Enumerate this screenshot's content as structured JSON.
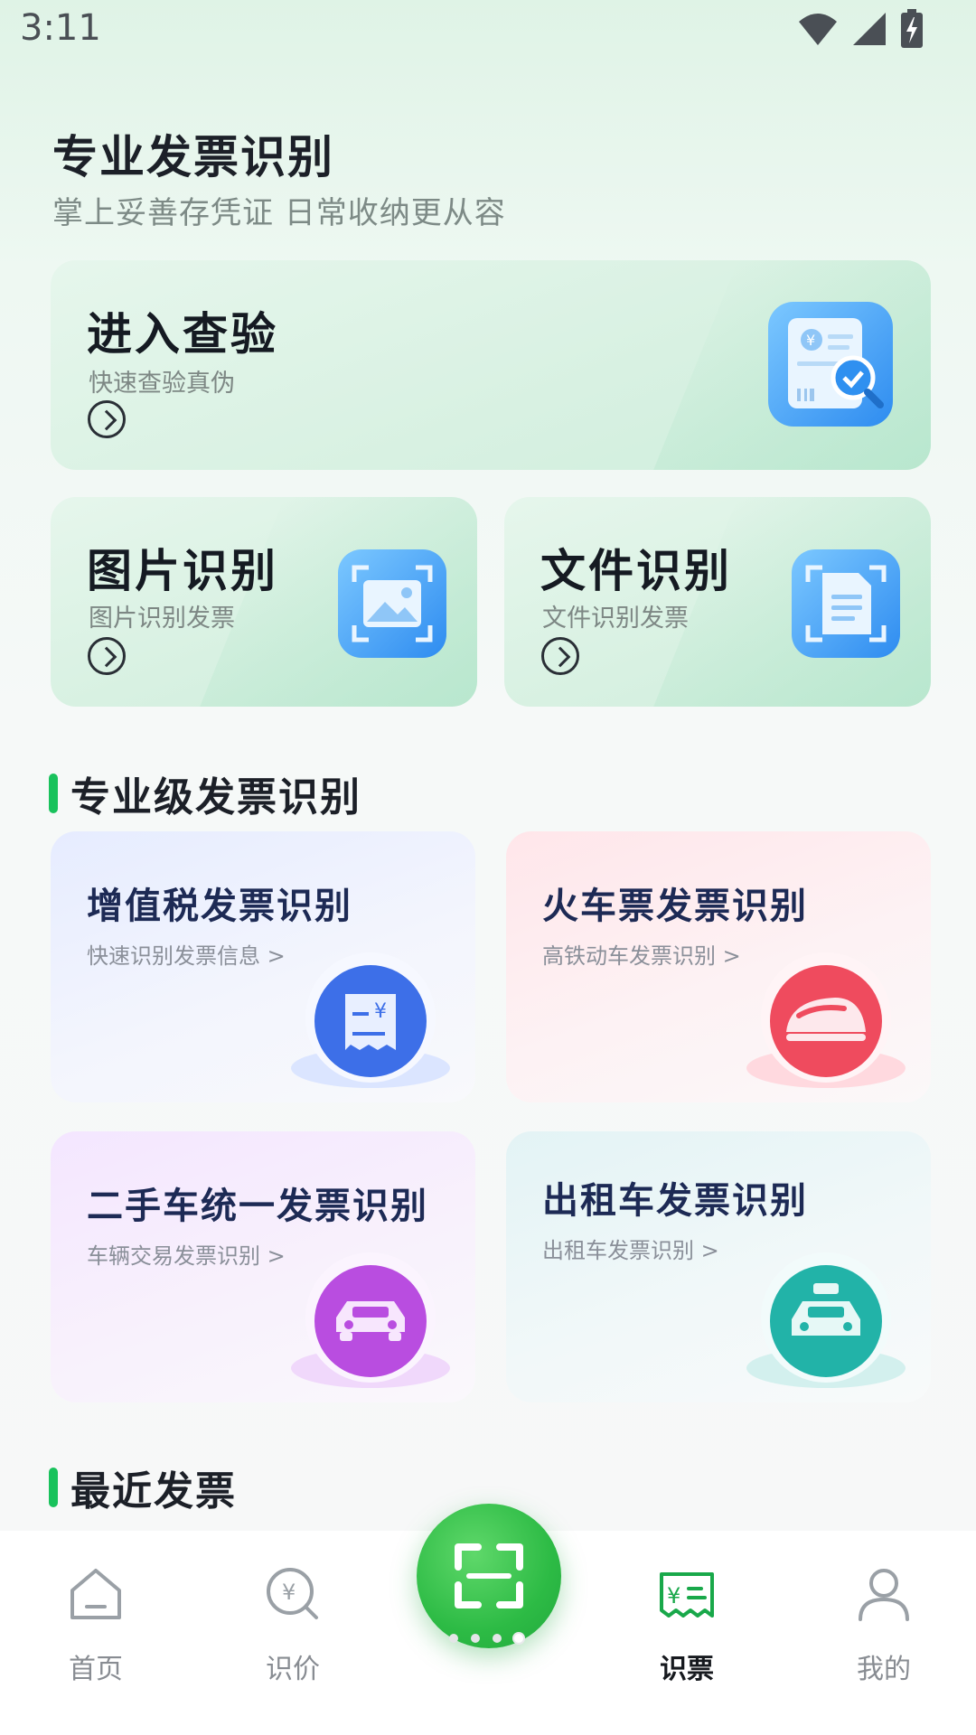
{
  "status_bar": {
    "time": "3:11"
  },
  "hero": {
    "title": "专业发票识别",
    "subtitle": "掌上妥善存凭证 日常收纳更从容"
  },
  "cards": {
    "verify": {
      "title": "进入查验",
      "subtitle": "快速查验真伪"
    },
    "image": {
      "title": "图片识别",
      "subtitle": "图片识别发票"
    },
    "file": {
      "title": "文件识别",
      "subtitle": "文件识别发票"
    }
  },
  "section_pro": {
    "title": "专业级发票识别"
  },
  "features": [
    {
      "title": "增值税发票识别",
      "subtitle": "快速识别发票信息 >",
      "icon": "tax-receipt-icon",
      "color": "#3d6fe8"
    },
    {
      "title": "火车票发票识别",
      "subtitle": "高铁动车发票识别 >",
      "icon": "bullet-train-icon",
      "color": "#ef4b5e"
    },
    {
      "title": "二手车统一发票识别",
      "subtitle": "车辆交易发票识别 >",
      "icon": "car-icon",
      "color": "#b94de0"
    },
    {
      "title": "出租车发票识别",
      "subtitle": "出租车发票识别 >",
      "icon": "taxi-icon",
      "color": "#22b3a8"
    }
  ],
  "section_recent": {
    "title": "最近发票"
  },
  "nav": {
    "items": [
      {
        "label": "首页",
        "icon": "home-icon",
        "active": false
      },
      {
        "label": "识价",
        "icon": "price-search-icon",
        "active": false
      },
      {
        "label": "识票",
        "icon": "ticket-icon",
        "active": true
      },
      {
        "label": "我的",
        "icon": "user-icon",
        "active": false
      }
    ],
    "scan": {
      "icon": "scan-icon"
    }
  },
  "colors": {
    "accent": "#19c25c",
    "scan_button": "#2dbb45"
  }
}
